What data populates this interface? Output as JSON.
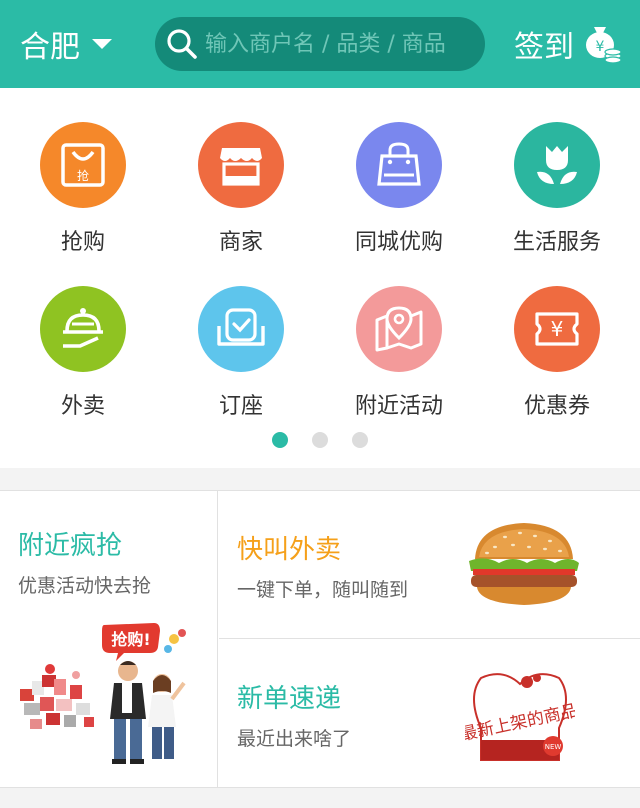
{
  "header": {
    "city": "合肥",
    "search_placeholder": "输入商户名 / 品类 / 商品",
    "signin_label": "签到"
  },
  "categories": [
    {
      "label": "抢购",
      "icon": "bag-icon",
      "color": "#f5882a",
      "badge": "抢"
    },
    {
      "label": "商家",
      "icon": "storefront-icon",
      "color": "#ef6b40"
    },
    {
      "label": "同城优购",
      "icon": "shopping-bag-icon",
      "color": "#7a87ee"
    },
    {
      "label": "生活服务",
      "icon": "tulip-icon",
      "color": "#2bb69f"
    },
    {
      "label": "外卖",
      "icon": "food-cloche-icon",
      "color": "#8fc322"
    },
    {
      "label": "订座",
      "icon": "seat-icon",
      "color": "#5ec5ec"
    },
    {
      "label": "附近活动",
      "icon": "map-pin-icon",
      "color": "#f39a9a"
    },
    {
      "label": "优惠券",
      "icon": "coupon-icon",
      "color": "#ef6b40",
      "badge": "¥"
    }
  ],
  "pagination": {
    "count": 3,
    "active": 0
  },
  "promo": {
    "left": {
      "title": "附近疯抢",
      "subtitle": "优惠活动快去抢",
      "badge": "抢购!"
    },
    "cards": [
      {
        "title": "快叫外卖",
        "subtitle": "一键下单，随叫随到",
        "title_color": "#f5a01a"
      },
      {
        "title": "新单速递",
        "subtitle": "最近出来啥了",
        "title_color": "#2bbba6",
        "image_text": "最新上架的商品",
        "image_badge": "NEW"
      }
    ]
  }
}
